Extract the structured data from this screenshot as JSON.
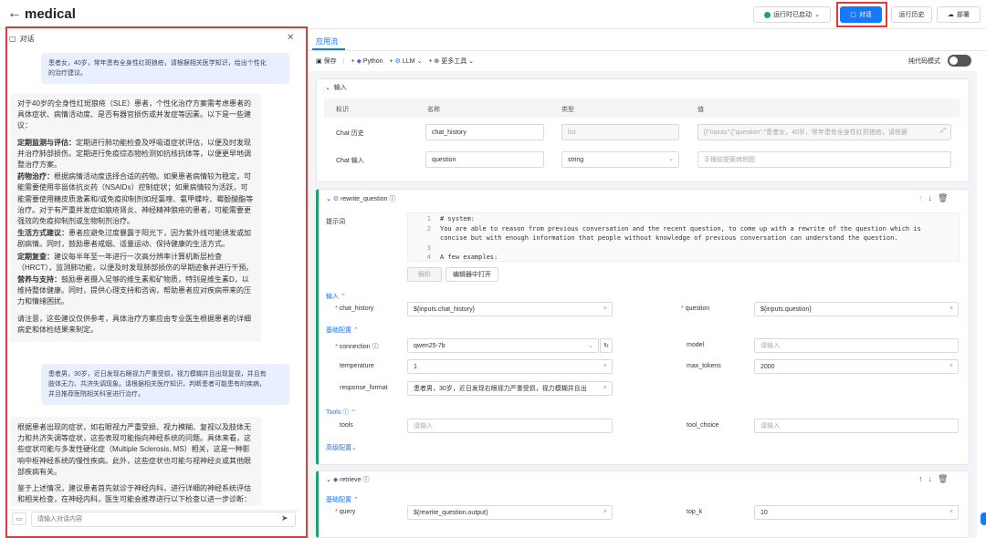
{
  "header": {
    "back": "←",
    "title": "medical",
    "status_label": "运行时已启动",
    "chat_label": "对话",
    "history_label": "运行历史",
    "deploy_label": "部署"
  },
  "chat": {
    "title": "对话",
    "messages": [
      {
        "role": "user",
        "lines": [
          "患者女，40岁，常年患有全身性红斑狼疮，请根据相关医学知识，给出个性化",
          "的治疗建议。"
        ]
      },
      {
        "role": "assistant",
        "paras": [
          {
            "b": "",
            "t": "对于40岁的全身性红斑狼疮（SLE）患者，个性化治疗方案需考虑患者的具体症状、病情活动度、是否有器官损伤或并发症等因素。以下是一些建议："
          },
          {
            "b": "定期监测与评估：",
            "t": "定期进行肺功能检查及呼吸道症状评估，以便及时发现并治疗肺部损伤。定期进行免疫综态物检测如抗核抗体等，以便更早地调整治疗方案。"
          },
          {
            "b": "药物治疗：",
            "t": "根据病情活动度选择合适的药物。如果患者病情较为稳定，可能需要使用非甾体抗炎药（NSAIDs）控制症状；如果病情较为活跃，可能需要使用糖皮质激素和/或免疫抑制剂如羟氯喹、氨甲蝶呤、霉酚酸酯等治疗。对于有严重并发症如狼疮肾炎、神经精神狼疮的患者，可能需要更强效的免疫抑制剂或生物制剂治疗。"
          },
          {
            "b": "生活方式建议：",
            "t": "患者应避免过度暴露于阳光下，因为紫外线可能诱发或加剧病情。同时，鼓励患者戒烟、适量运动、保持健康的生活方式。"
          },
          {
            "b": "定期复查：",
            "t": "建议每半年至一年进行一次高分辨率计算机断层检查（HRCT），监测肺功能，以便及时发现肺部损伤的早期迹象并进行干预。"
          },
          {
            "b": "营养与支持：",
            "t": "鼓励患者摄入足够的维生素和矿物质，特别是维生素D，以维持整体健康。同时，提供心理支持和咨询，帮助患者应对疾病带来的压力和情绪困扰。"
          },
          {
            "b": "",
            "t": "请注意，这些建议仅供参考，具体治疗方案应由专业医生根据患者的详细病史和体检结果来制定。"
          }
        ]
      },
      {
        "role": "user",
        "lines": [
          "患者男，30岁，近日发现右眼视力严重受损，视力模糊并且出现复视，并且有",
          "肢体无力、共济失调现象。请根据相关医疗知识，判断患者可能患有的疾病，",
          "并且推荐医院相关科室进行治疗。"
        ]
      },
      {
        "role": "assistant",
        "paras": [
          {
            "b": "",
            "t": "根据患者出现的症状，如右眼视力严重受损、视力模糊、复视以及肢体无力和共济失调等症状，这些表现可能指向神经系统的问题。具体来看，这些症状可能与多发性硬化症（Multiple Sclerosis, MS）相关，这是一种影响中枢神经系统的慢性疾病。此外，这些症状也可能与视神经炎或其他眼部疾病有关。"
          },
          {
            "b": "",
            "t": "鉴于上述情况，建议患者首先就诊于神经内科，进行详细的神经系统评估和相关检查，在神经内科，医生可能会推荐进行以下检查以进一步诊断："
          }
        ]
      }
    ],
    "input_placeholder": "请输入对话内容"
  },
  "flow": {
    "tab": "应用流",
    "toolbar": {
      "save": "保存",
      "python": "Python",
      "llm": "LLM",
      "more": "更多工具"
    },
    "code_mode": "纯代码模式",
    "input_node": {
      "title": "输入",
      "headers": [
        "标识",
        "名称",
        "类型",
        "值"
      ],
      "rows": [
        {
          "label": "Chat 历史",
          "name": "chat_history",
          "type": "list",
          "value": "[{\"inputs\":{\"question\":\"患者女，40岁，常年患有全身性红斑狼疮，请根据"
        },
        {
          "label": "Chat 输入",
          "name": "question",
          "type": "string",
          "value": "",
          "placeholder": "手横前提案病例图"
        }
      ]
    },
    "rewrite_node": {
      "title": "rewrite_question",
      "prompt_label": "提示词",
      "code_lines": [
        {
          "n": "1",
          "t": "# system:"
        },
        {
          "n": "2",
          "t": "You are able to reason from previous conversation and the recent question, to come up with a rewrite of the question which is"
        },
        {
          "n": "",
          "t": "concise but with enough information that people without knowledge of previous conversation can understand the question."
        },
        {
          "n": "3",
          "t": ""
        },
        {
          "n": "4",
          "t": "A few examples:"
        }
      ],
      "parse_btn": "解析",
      "open_editor_btn": "编辑器中打开",
      "input_section": "输入",
      "chat_history_label": "chat_history",
      "chat_history_value": "${inputs.chat_history}",
      "question_label": "question",
      "question_value": "${inputs.question}",
      "basic_section": "基础配置",
      "connection_label": "connection",
      "connection_value": "qwen25-7b",
      "model_label": "model",
      "model_placeholder": "请输入",
      "temperature_label": "temperature",
      "temperature_value": "1",
      "max_tokens_label": "max_tokens",
      "max_tokens_value": "2000",
      "response_format_label": "response_format",
      "response_format_value": "患者男，30岁，近日发现右眼视力严重受损，视力模糊并且出",
      "tools_section": "Tools",
      "tools_label": "tools",
      "tools_placeholder": "请输入",
      "tool_choice_label": "tool_choice",
      "tool_choice_placeholder": "请输入",
      "advanced_section": "高级配置"
    },
    "retrieve_node": {
      "title": "retrieve",
      "basic_section": "基础配置",
      "query_label": "query",
      "query_value": "${rewrite_question.output}",
      "top_k_label": "top_k",
      "top_k_value": "10"
    }
  },
  "colors": {
    "accent": "#1677ff",
    "highlight": "#e53935",
    "node_green": "#22a06b"
  }
}
